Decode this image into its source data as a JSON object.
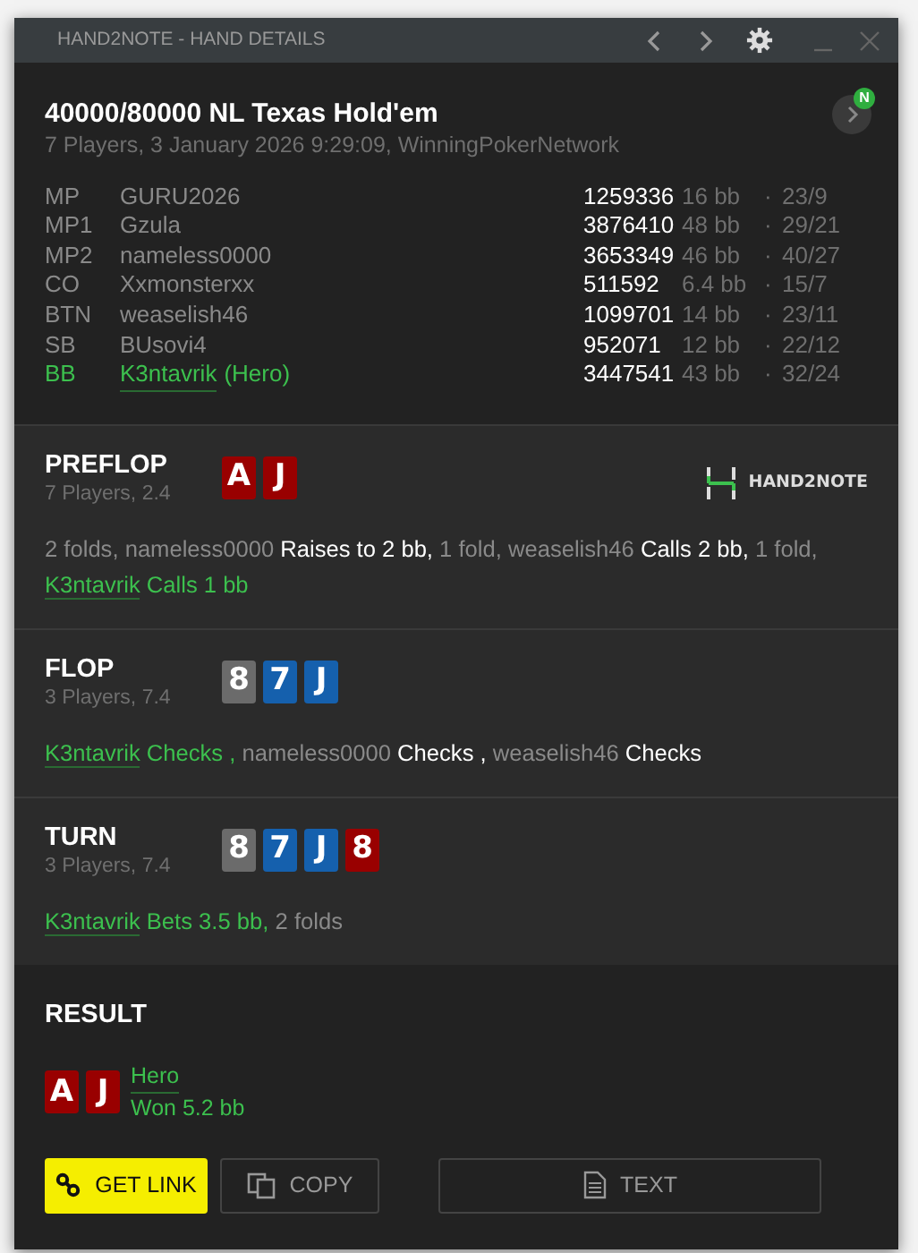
{
  "window": {
    "title": "HAND2NOTE - HAND DETAILS"
  },
  "header": {
    "title": "40000/80000 NL Texas Hold'em",
    "subtitle": "7 Players, 3 January 2026 9:29:09, WinningPokerNetwork",
    "badge": "N"
  },
  "players": [
    {
      "position": "MP",
      "name": "GURU2026",
      "hero": false,
      "stack": "1259336",
      "bb": "16 bb",
      "dot": "·",
      "stats": "23/9"
    },
    {
      "position": "MP1",
      "name": "Gzula",
      "hero": false,
      "stack": "3876410",
      "bb": "48 bb",
      "dot": "·",
      "stats": "29/21"
    },
    {
      "position": "MP2",
      "name": "nameless0000",
      "hero": false,
      "stack": "3653349",
      "bb": "46 bb",
      "dot": "·",
      "stats": "40/27"
    },
    {
      "position": "CO",
      "name": "Xxmonsterxx",
      "hero": false,
      "stack": "511592",
      "bb": "6.4 bb",
      "dot": "·",
      "stats": "15/7"
    },
    {
      "position": "BTN",
      "name": "weaselish46",
      "hero": false,
      "stack": "1099701",
      "bb": "14 bb",
      "dot": "·",
      "stats": "23/11"
    },
    {
      "position": "SB",
      "name": "BUsovi4",
      "hero": false,
      "stack": "952071",
      "bb": "12 bb",
      "dot": "·",
      "stats": "22/12"
    },
    {
      "position": "BB",
      "name": "K3ntavrik",
      "suffix": "(Hero)",
      "hero": true,
      "stack": "3447541",
      "bb": "43 bb",
      "dot": "·",
      "stats": "32/24"
    }
  ],
  "streets": [
    {
      "name": "PREFLOP",
      "info": "7 Players, 2.4",
      "logo": "HAND2NOTE",
      "cards": [
        {
          "rank": "A",
          "color": "#990000"
        },
        {
          "rank": "J",
          "color": "#990000"
        }
      ],
      "actions": [
        {
          "kind": "other",
          "text": "2 folds, "
        },
        {
          "kind": "player",
          "text": "nameless0000 "
        },
        {
          "kind": "action",
          "text": "Raises to 2 bb, "
        },
        {
          "kind": "other",
          "text": "1 fold, "
        },
        {
          "kind": "player",
          "text": "weaselish46 "
        },
        {
          "kind": "action",
          "text": "Calls 2 bb, "
        },
        {
          "kind": "other",
          "text": "1 fold, "
        },
        {
          "kind": "hero",
          "text": "K3ntavrik"
        },
        {
          "kind": "hero_action",
          "text": " Calls 1 bb"
        }
      ]
    },
    {
      "name": "FLOP",
      "info": "3 Players, 7.4",
      "cards": [
        {
          "rank": "8",
          "color": "#6b6b6b"
        },
        {
          "rank": "7",
          "color": "#1560ad"
        },
        {
          "rank": "J",
          "color": "#1560ad"
        }
      ],
      "actions": [
        {
          "kind": "hero",
          "text": "K3ntavrik"
        },
        {
          "kind": "hero_action",
          "text": " Checks , "
        },
        {
          "kind": "player",
          "text": "nameless0000 "
        },
        {
          "kind": "action",
          "text": "Checks , "
        },
        {
          "kind": "player",
          "text": "weaselish46 "
        },
        {
          "kind": "action",
          "text": "Checks"
        }
      ]
    },
    {
      "name": "TURN",
      "info": "3 Players, 7.4",
      "cards": [
        {
          "rank": "8",
          "color": "#6b6b6b"
        },
        {
          "rank": "7",
          "color": "#1560ad"
        },
        {
          "rank": "J",
          "color": "#1560ad"
        },
        {
          "rank": "8",
          "color": "#990000"
        }
      ],
      "actions": [
        {
          "kind": "hero",
          "text": "K3ntavrik"
        },
        {
          "kind": "hero_action",
          "text": " Bets 3.5 bb, "
        },
        {
          "kind": "other",
          "text": "2 folds"
        }
      ]
    }
  ],
  "result": {
    "title": "RESULT",
    "cards": [
      {
        "rank": "A",
        "color": "#990000"
      },
      {
        "rank": "J",
        "color": "#990000"
      }
    ],
    "winner": "Hero",
    "amount": "Won 5.2 bb"
  },
  "buttons": [
    {
      "kind": "link",
      "label": "GET LINK"
    },
    {
      "kind": "copy",
      "label": "COPY"
    },
    {
      "kind": "text",
      "label": "TEXT"
    }
  ]
}
